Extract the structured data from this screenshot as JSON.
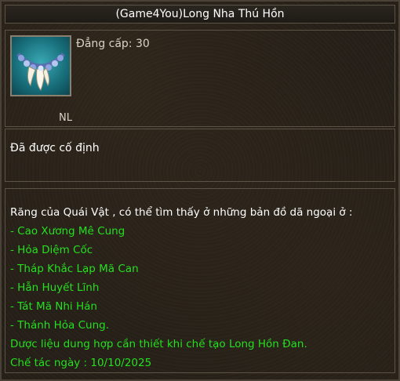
{
  "title": "(Game4You)Long Nha Thú Hồn",
  "item": {
    "icon": "dragon-fang-necklace-icon",
    "level_label": "Đẳng cấp: 30",
    "type_label": "NL"
  },
  "binding_text": "Đã được cố định",
  "description": {
    "intro": "Răng của Quái Vật , có thể tìm thấy ở những bản đồ dã ngoại ở :",
    "locations": [
      "Cao Xương Mê Cung",
      "Hỏa Diệm Cốc",
      "Tháp Khắc Lạp Mã Can",
      "Hẫn Huyết Lĩnh",
      "Tát Mã Nhi Hán",
      "Thánh Hỏa Cung."
    ],
    "craft_note": "Dược liệu dung hợp cần thiết khi chế tạo Long Hồn Đan.",
    "craft_date": "Chế tác ngày : 10/10/2025"
  },
  "colors": {
    "text_white": "#ffffff",
    "text_green": "#25e01f",
    "border": "#5b5345",
    "background": "#241f18"
  }
}
